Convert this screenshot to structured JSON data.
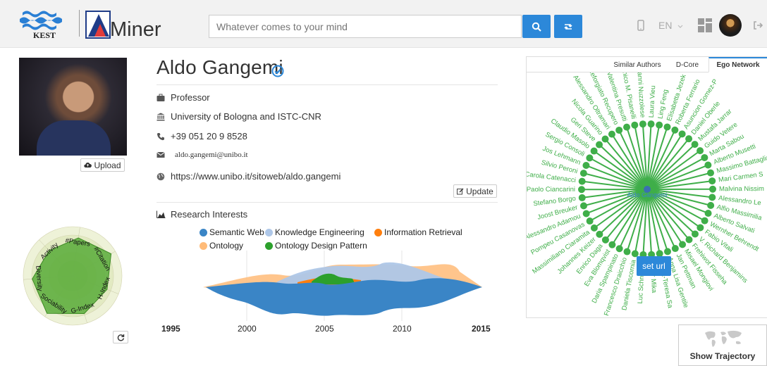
{
  "header": {
    "logo_kest_text": "KEST",
    "logo_miner_text": "Miner",
    "search_placeholder": "Whatever comes to your mind",
    "language": "EN"
  },
  "profile": {
    "name": "Aldo Gangemi",
    "position": "Professor",
    "affiliation": "University of Bologna and ISTC-CNR",
    "phone": "+39 051 20 9 8528",
    "email": "aldo.gangemi@unibo.it",
    "homepage": "https://www.unibo.it/sitoweb/aldo.gangemi",
    "upload_label": "Upload",
    "update_label": "Update"
  },
  "radar": {
    "axes": [
      "#Papers",
      "#Citation",
      "H-Index",
      "G-Index",
      "Sociability",
      "Diversity",
      "Activity"
    ]
  },
  "research": {
    "title": "Research Interests",
    "legend": [
      {
        "name": "Semantic Web",
        "color": "#3a85c6"
      },
      {
        "name": "Knowledge Engineering",
        "color": "#aec7e8"
      },
      {
        "name": "Information Retrieval",
        "color": "#ff7f0e"
      },
      {
        "name": "Ontology",
        "color": "#ffbb78"
      },
      {
        "name": "Ontology Design Pattern",
        "color": "#2ca02c"
      }
    ],
    "years": [
      "1995",
      "2000",
      "2005",
      "2010",
      "2015"
    ]
  },
  "ego": {
    "tabs": [
      "Similar Authors",
      "D-Core",
      "Ego Network"
    ],
    "active_tab": "Ego Network",
    "center": "Aldo Gangemi",
    "color": "#3fae49",
    "nodes": [
      "Laura Vieu",
      "Ling Feng",
      "Elisabetta Jezek",
      "Roberta Ferrario",
      "Asuncion Gomez-P",
      "Daniel Oberle",
      "Mustafa Jarrar",
      "Guido Vetere",
      "Marta Sabou",
      "Alberto Musetti",
      "Massimo Battaglia",
      "Mari Carmen S",
      "Malvina Nissim",
      "Alessandro Le",
      "Alfio Massimilia",
      "Alberto Salvati",
      "Wernher Behrendt",
      "Fabio Vitali",
      "V. Richard Benjamins",
      "Frehiwot Fisseha",
      "Misael Mongiovi",
      "Jan Pettman",
      "Anna Lisa Gentile",
      "Maria-Teresa Sa",
      "Peter Mika",
      "Luc Schneider",
      "Daniela Tiscornia",
      "Francesco Draicchio",
      "Daria Spampinato",
      "Eva Blomqvist",
      "Enrico Daga",
      "Johannes Keizer",
      "Massimiliano Ciaramita",
      "Pompeu Casanovas",
      "Alessandro Adamou",
      "Joost Breuker",
      "Stefano Borgo",
      "Paolo Ciancarini",
      "Carola Catenacci",
      "Silvio Peroni",
      "Jos Lehmann",
      "Sergio Consoli",
      "Claudio Masolo",
      "Geri Steve",
      "Nicola Guarino",
      "Alessandro Oltramari",
      "Diego Reforgiato Recupero",
      "Valentina Presutti",
      "Domenico M. Pisanelli",
      "Giovanni Nuzzolese"
    ]
  },
  "actions": {
    "set_url": "set url",
    "show_trajectory": "Show Trajectory"
  }
}
